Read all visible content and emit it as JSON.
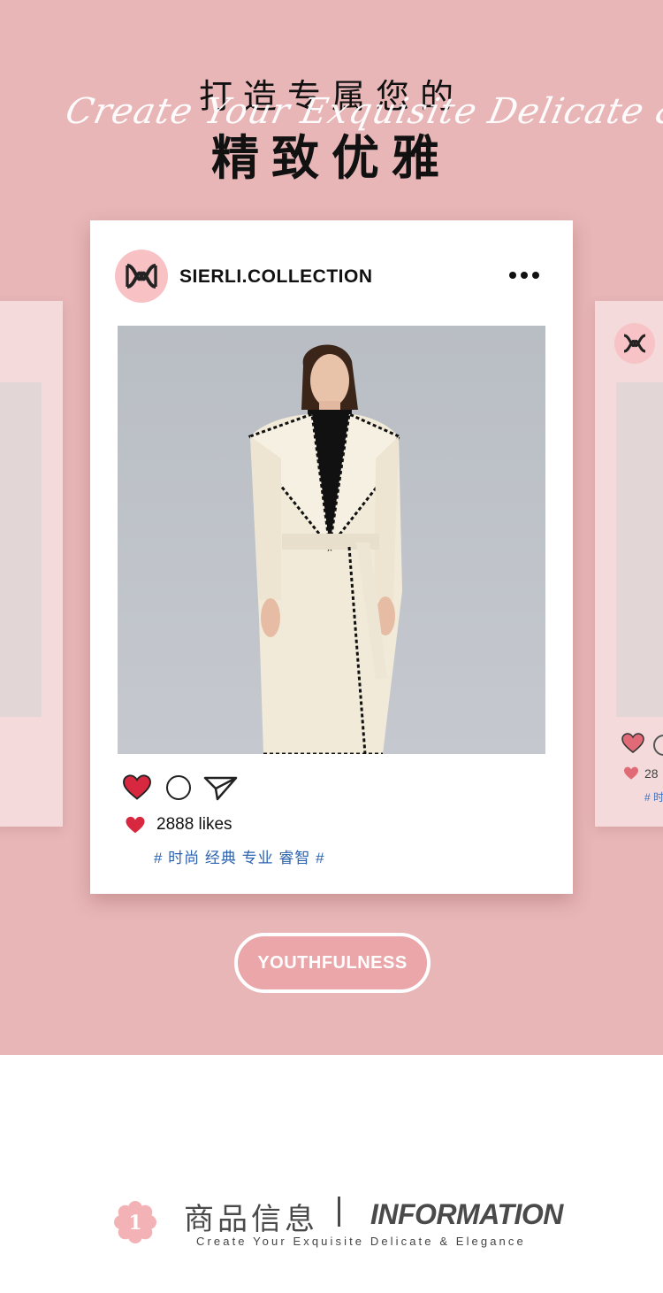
{
  "hero": {
    "headline_top": "打造专属您的",
    "headline_main": "精致优雅",
    "script_text": "Create Your Exquisite Delicate & Elegance"
  },
  "post": {
    "account_name": "SIERLI.COLLECTION",
    "likes": "2888 likes",
    "hashtags": "# 时尚 经典 专业 睿智 #",
    "photo_icon": "model-photo"
  },
  "side_post": {
    "likes": "28",
    "tag": "# 时"
  },
  "badge": {
    "label": "YOUTHFULNESS"
  },
  "section": {
    "number": "1",
    "title_cn": "商品信息",
    "title_en": "INFORMATION",
    "subtitle": "Create Your Exquisite Delicate & Elegance"
  },
  "colors": {
    "hero_bg": "#e8b6b7",
    "heart": "#d8283f",
    "hashtag": "#2a62b0",
    "accent_pink": "#eaa6a9"
  }
}
